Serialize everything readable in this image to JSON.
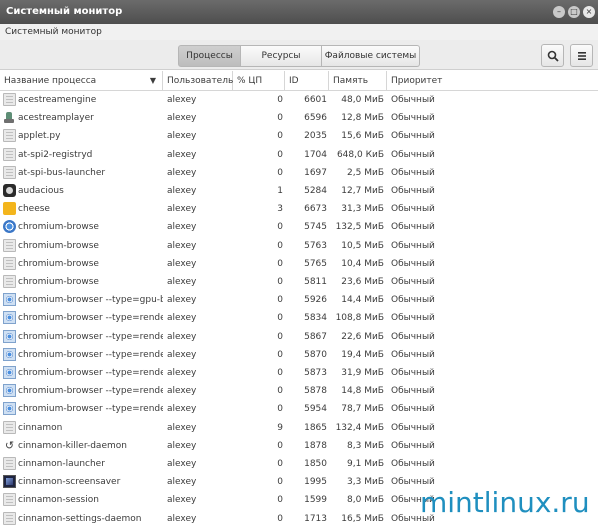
{
  "window": {
    "title": "Системный монитор",
    "menubar_title": "Системный монитор"
  },
  "toolbar": {
    "tabs": [
      {
        "label": "Процессы",
        "active": true
      },
      {
        "label": "Ресурсы",
        "active": false
      },
      {
        "label": "Файловые системы",
        "active": false
      }
    ],
    "search_icon": "search-icon",
    "menu_icon": "hamburger-menu-icon"
  },
  "table": {
    "columns": [
      "Название процесса",
      "Пользователь",
      "% ЦП",
      "ID",
      "Память",
      "Приоритет"
    ],
    "sort_indicator": "▼",
    "rows": [
      {
        "icon": "generic",
        "name": "acestreamengine",
        "user": "alexey",
        "cpu": "0",
        "id": "6601",
        "mem": "48,0 МиБ",
        "pri": "Обычный"
      },
      {
        "icon": "player",
        "name": "acestreamplayer",
        "user": "alexey",
        "cpu": "0",
        "id": "6596",
        "mem": "12,8 МиБ",
        "pri": "Обычный"
      },
      {
        "icon": "generic",
        "name": "applet.py",
        "user": "alexey",
        "cpu": "0",
        "id": "2035",
        "mem": "15,6 МиБ",
        "pri": "Обычный"
      },
      {
        "icon": "generic",
        "name": "at-spi2-registryd",
        "user": "alexey",
        "cpu": "0",
        "id": "1704",
        "mem": "648,0 КиБ",
        "pri": "Обычный"
      },
      {
        "icon": "generic",
        "name": "at-spi-bus-launcher",
        "user": "alexey",
        "cpu": "0",
        "id": "1697",
        "mem": "2,5 МиБ",
        "pri": "Обычный"
      },
      {
        "icon": "audacious",
        "name": "audacious",
        "user": "alexey",
        "cpu": "1",
        "id": "5284",
        "mem": "12,7 МиБ",
        "pri": "Обычный"
      },
      {
        "icon": "cheese",
        "name": "cheese",
        "user": "alexey",
        "cpu": "3",
        "id": "6673",
        "mem": "31,3 МиБ",
        "pri": "Обычный"
      },
      {
        "icon": "chromium",
        "name": "chromium-browse",
        "user": "alexey",
        "cpu": "0",
        "id": "5745",
        "mem": "132,5 МиБ",
        "pri": "Обычный"
      },
      {
        "icon": "generic",
        "name": "chromium-browse",
        "user": "alexey",
        "cpu": "0",
        "id": "5763",
        "mem": "10,5 МиБ",
        "pri": "Обычный"
      },
      {
        "icon": "generic",
        "name": "chromium-browse",
        "user": "alexey",
        "cpu": "0",
        "id": "5765",
        "mem": "10,4 МиБ",
        "pri": "Обычный"
      },
      {
        "icon": "generic",
        "name": "chromium-browse",
        "user": "alexey",
        "cpu": "0",
        "id": "5811",
        "mem": "23,6 МиБ",
        "pri": "Обычный"
      },
      {
        "icon": "chromium-sq",
        "name": "chromium-browser --type=gpu-broker",
        "user": "alexey",
        "cpu": "0",
        "id": "5926",
        "mem": "14,4 МиБ",
        "pri": "Обычный"
      },
      {
        "icon": "chromium-sq",
        "name": "chromium-browser --type=renderer",
        "user": "alexey",
        "cpu": "0",
        "id": "5834",
        "mem": "108,8 МиБ",
        "pri": "Обычный"
      },
      {
        "icon": "chromium-sq",
        "name": "chromium-browser --type=renderer",
        "user": "alexey",
        "cpu": "0",
        "id": "5867",
        "mem": "22,6 МиБ",
        "pri": "Обычный"
      },
      {
        "icon": "chromium-sq",
        "name": "chromium-browser --type=renderer",
        "user": "alexey",
        "cpu": "0",
        "id": "5870",
        "mem": "19,4 МиБ",
        "pri": "Обычный"
      },
      {
        "icon": "chromium-sq",
        "name": "chromium-browser --type=renderer",
        "user": "alexey",
        "cpu": "0",
        "id": "5873",
        "mem": "31,9 МиБ",
        "pri": "Обычный"
      },
      {
        "icon": "chromium-sq",
        "name": "chromium-browser --type=renderer",
        "user": "alexey",
        "cpu": "0",
        "id": "5878",
        "mem": "14,8 МиБ",
        "pri": "Обычный"
      },
      {
        "icon": "chromium-sq",
        "name": "chromium-browser --type=renderer",
        "user": "alexey",
        "cpu": "0",
        "id": "5954",
        "mem": "78,7 МиБ",
        "pri": "Обычный"
      },
      {
        "icon": "generic",
        "name": "cinnamon",
        "user": "alexey",
        "cpu": "9",
        "id": "1865",
        "mem": "132,4 МиБ",
        "pri": "Обычный"
      },
      {
        "icon": "killer",
        "name": "cinnamon-killer-daemon",
        "user": "alexey",
        "cpu": "0",
        "id": "1878",
        "mem": "8,3 МиБ",
        "pri": "Обычный"
      },
      {
        "icon": "generic",
        "name": "cinnamon-launcher",
        "user": "alexey",
        "cpu": "0",
        "id": "1850",
        "mem": "9,1 МиБ",
        "pri": "Обычный"
      },
      {
        "icon": "screensaver",
        "name": "cinnamon-screensaver",
        "user": "alexey",
        "cpu": "0",
        "id": "1995",
        "mem": "3,3 МиБ",
        "pri": "Обычный"
      },
      {
        "icon": "generic",
        "name": "cinnamon-session",
        "user": "alexey",
        "cpu": "0",
        "id": "1599",
        "mem": "8,0 МиБ",
        "pri": "Обычный"
      },
      {
        "icon": "generic",
        "name": "cinnamon-settings-daemon",
        "user": "alexey",
        "cpu": "0",
        "id": "1713",
        "mem": "16,5 МиБ",
        "pri": "Обычный"
      }
    ]
  },
  "watermark": "mintlinux.ru"
}
